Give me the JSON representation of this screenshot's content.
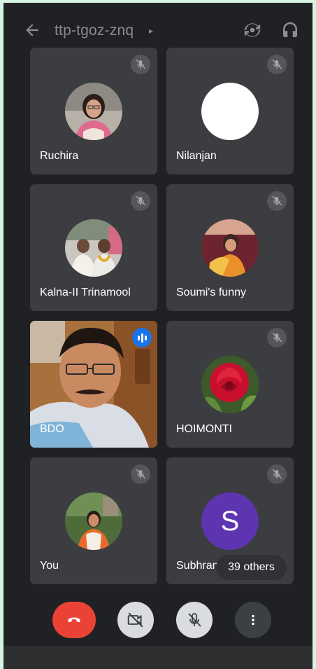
{
  "header": {
    "meeting_code": "ttp-tgoz-znq",
    "caret": "▸",
    "back_icon": "arrow-back-icon",
    "camera_switch_icon": "switch-camera-icon",
    "audio_icon": "headphones-icon"
  },
  "participants": [
    {
      "name": "Ruchira",
      "muted": true
    },
    {
      "name": "Nilanjan",
      "muted": true
    },
    {
      "name": "Kalna-II Trinamool",
      "muted": true
    },
    {
      "name": "Soumi's funny",
      "muted": true
    },
    {
      "name": "BDO",
      "muted": false,
      "speaking": true,
      "video": true
    },
    {
      "name": "HOIMONTI",
      "muted": true
    },
    {
      "name": "You",
      "muted": true
    },
    {
      "name": "Subhrani",
      "muted": true,
      "initial": "S"
    }
  ],
  "others_label": "39 others",
  "controls": {
    "end_call_icon": "phone-hangup-icon",
    "camera_icon": "camera-off-icon",
    "mic_icon": "mic-off-icon",
    "more_icon": "more-vert-icon"
  },
  "colors": {
    "background": "#202124",
    "tile": "#3c3d40",
    "end_call": "#ea4335",
    "speaking": "#1a73e8",
    "avatar_s": "#5e35b1"
  }
}
